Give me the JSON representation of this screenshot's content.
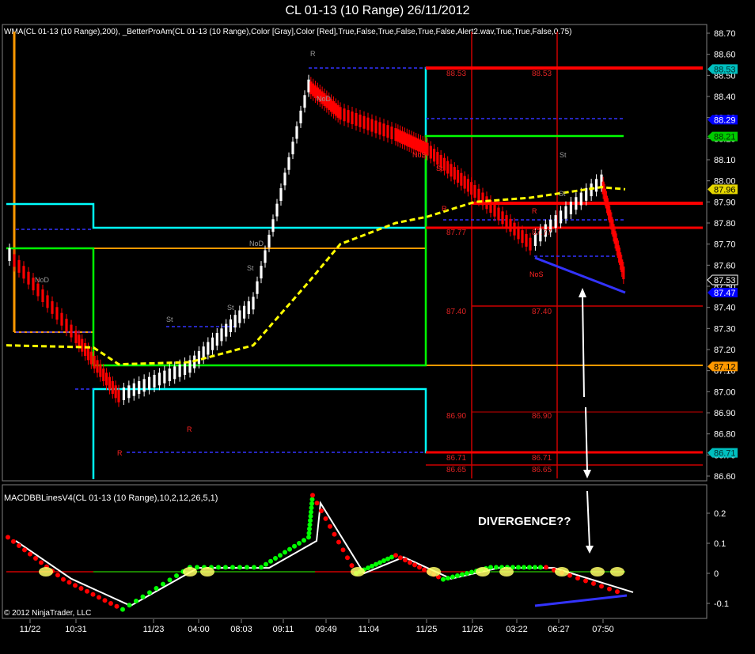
{
  "window": {
    "title": "CL 01-13 (10 Range)  26/11/2012"
  },
  "price_panel": {
    "indicator_text": "WMA(CL 01-13 (10 Range),200), _BetterProAm(CL 01-13 (10 Range),Color [Gray],Color [Red],True,False,True,False,True,False,Alert2.wav,True,True,False,0.75)",
    "y_ticks": [
      "88.70",
      "88.60",
      "88.50",
      "88.40",
      "88.30",
      "88.20",
      "88.10",
      "88.00",
      "87.90",
      "87.80",
      "87.70",
      "87.60",
      "87.50",
      "87.40",
      "87.30",
      "87.20",
      "87.10",
      "87.00",
      "86.90",
      "86.80",
      "86.70",
      "86.60"
    ],
    "price_tags": [
      {
        "label": "88.53",
        "bg": "#00BFBF",
        "fg": "#003030"
      },
      {
        "label": "88.29",
        "bg": "#0000FF",
        "fg": "#FFFFFF"
      },
      {
        "label": "88.21",
        "bg": "#00CC00",
        "fg": "#003000"
      },
      {
        "label": "87.96",
        "bg": "#E5D600",
        "fg": "#000000"
      },
      {
        "label": "87.53",
        "bg": "#000000",
        "fg": "#FFFFFF"
      },
      {
        "label": "87.47",
        "bg": "#0000FF",
        "fg": "#FFFFFF"
      },
      {
        "label": "87.12",
        "bg": "#FF9900",
        "fg": "#000000"
      },
      {
        "label": "86.71",
        "bg": "#00BFBF",
        "fg": "#003030"
      }
    ],
    "level_labels": {
      "left": [
        "88.53",
        "87.77",
        "87.40",
        "86.90",
        "86.71",
        "86.65"
      ],
      "right": [
        "88.53",
        "87.77",
        "87.40",
        "86.90",
        "86.71",
        "86.65"
      ]
    },
    "markers": [
      "R",
      "NoD",
      "NoD",
      "St",
      "St",
      "NoD",
      "St",
      "NoS",
      "St",
      "R",
      "R",
      "R",
      "St",
      "R",
      "St",
      "NoS"
    ],
    "colors": {
      "up_candle": "#FFFFFF",
      "down_candle": "#FF0000",
      "wma": "#FFFF00",
      "support_red": "#FF0000",
      "cyan": "#00FFFF",
      "green": "#00FF00",
      "orange": "#FF9900",
      "blue_dash": "#3333FF"
    }
  },
  "macd_panel": {
    "indicator_text": "MACDBBLinesV4(CL 01-13 (10 Range),10,2,12,26,5,1)",
    "y_ticks": [
      "0.2",
      "0.1",
      "0",
      "-0.1"
    ],
    "annotation": "DIVERGENCE??",
    "copyright": "© 2012 NinjaTrader, LLC"
  },
  "x_axis": {
    "labels": [
      "11/22",
      "10:31",
      "11/23",
      "04:00",
      "08:03",
      "09:11",
      "09:49",
      "11:04",
      "11/25",
      "11/26",
      "03:22",
      "06:27",
      "07:50"
    ]
  },
  "chart_data": {
    "type": "line",
    "title": "CL 01-13 (10 Range)  26/11/2012",
    "x": [
      "11/22",
      "10:31",
      "11/23",
      "04:00",
      "08:03",
      "09:11",
      "09:49",
      "11:04",
      "11/25",
      "11/26",
      "03:22",
      "06:27",
      "07:50"
    ],
    "series": [
      {
        "name": "",
        "values": [
          87.65,
          87.26,
          86.98,
          87.12,
          87.42,
          88.45,
          88.32,
          88.22,
          88.15,
          87.95,
          87.7,
          88.0,
          87.53
        ]
      },
      {
        "name": "",
        "values": [
          87.22,
          87.21,
          87.13,
          87.14,
          87.22,
          87.52,
          87.7,
          87.8,
          87.83,
          87.9,
          87.92,
          87.97,
          87.96
        ]
      }
    ],
    "macd_series": [
      {
        "name": "",
        "values": [
          0.12,
          -0.02,
          -0.12,
          0.02,
          0.02,
          0.12,
          0.26,
          0.0,
          0.06,
          -0.02,
          0.02,
          0.02,
          -0.07
        ]
      }
    ],
    "ylim": [
      86.57,
      88.77
    ],
    "macd_ylim": [
      -0.14,
      0.26
    ],
    "xlabel": "",
    "ylabel": "",
    "grid": false
  }
}
